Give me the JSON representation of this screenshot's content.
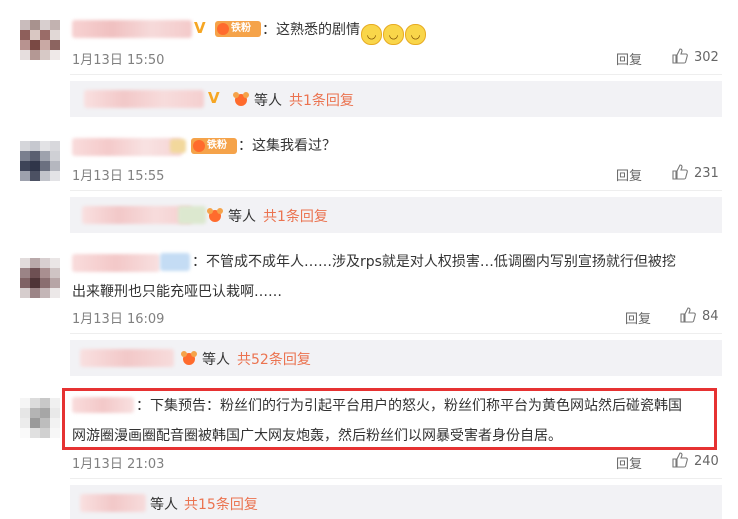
{
  "comments": [
    {
      "text": "：这熟悉的剧情",
      "emoji_count": 3,
      "time": "1月13日 15:50",
      "reply_label": "回复",
      "likes": "302",
      "badge": "铁粉",
      "replies": {
        "etc": "等人",
        "count": "共1条回复"
      }
    },
    {
      "text": "：这集我看过？",
      "time": "1月13日 15:55",
      "reply_label": "回复",
      "likes": "231",
      "badge": "铁粉",
      "replies": {
        "etc": "等人",
        "count": "共1条回复"
      }
    },
    {
      "text": "：不管成不成年人……涉及rps就是对人权损害…低调圈内写别宣扬就行但被挖",
      "text2": "出来鞭刑也只能充哑巴认栽啊……",
      "time": "1月13日 16:09",
      "reply_label": "回复",
      "likes": "84",
      "replies": {
        "etc": "等人",
        "count": "共52条回复"
      }
    },
    {
      "text": "：下集预告：粉丝们的行为引起平台用户的怒火，粉丝们称平台为黄色网站然后碰瓷韩国",
      "text2": "网游圈漫画圈配音圈被韩国广大网友炮轰，然后粉丝们以网暴受害者身份自居。",
      "time": "1月13日 21:03",
      "reply_label": "回复",
      "likes": "240",
      "replies": {
        "etc": "等人",
        "count": "共15条回复"
      }
    }
  ],
  "icons": {
    "like": "thumbs-up-icon",
    "verified": "verified-v-icon",
    "fan": "fan-badge-icon"
  },
  "colors": {
    "highlight_border": "#e63232",
    "reply_count": "#eb7350",
    "reply_box_bg": "#f2f2f5",
    "badge_bg": "#f5a34a"
  }
}
